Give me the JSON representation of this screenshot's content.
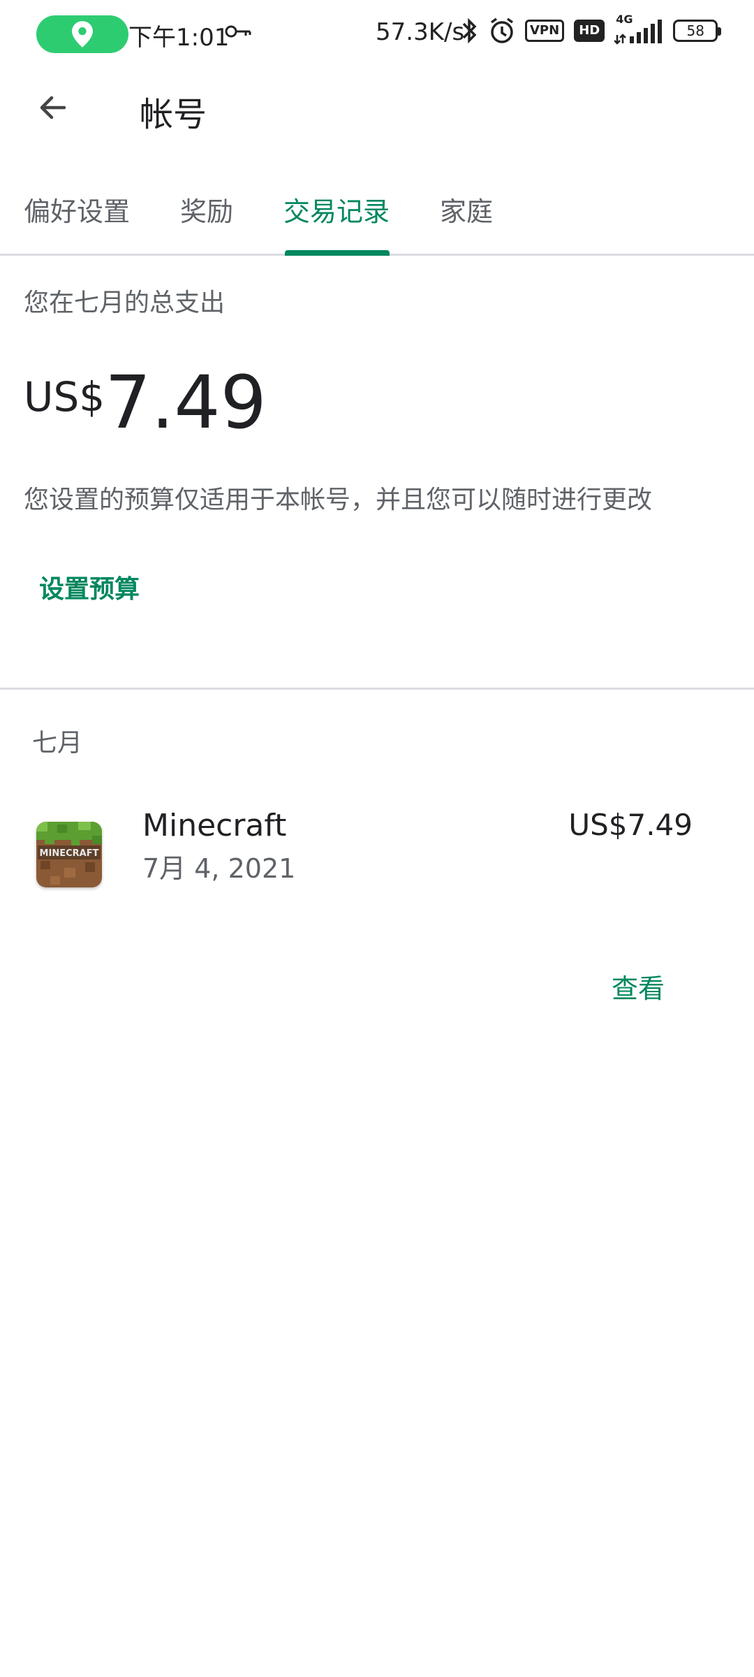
{
  "status_bar": {
    "time": "下午1:01",
    "net_speed": "57.3K/s",
    "vpn": "VPN",
    "hd": "HD",
    "network": "4G",
    "battery": "58",
    "icons": [
      "location-icon",
      "key-icon",
      "bluetooth-icon",
      "alarm-icon",
      "signal-icon"
    ]
  },
  "app_bar": {
    "title": "帐号",
    "back_icon": "arrow-back-icon"
  },
  "tabs": [
    {
      "label": "偏好设置"
    },
    {
      "label": "奖励"
    },
    {
      "label": "交易记录",
      "active": true
    },
    {
      "label": "家庭"
    }
  ],
  "summary": {
    "label": "您在七月的总支出",
    "currency": "US$",
    "amount": "7.49",
    "budget_note": "您设置的预算仅适用于本帐号，并且您可以随时进行更改",
    "set_budget": "设置预算"
  },
  "transactions": {
    "month": "七月",
    "items": [
      {
        "title": "Minecraft",
        "date": "7月 4, 2021",
        "price": "US$7.49",
        "icon": "minecraft-app-icon",
        "icon_text": "MINECRAFT"
      }
    ],
    "view_label": "查看"
  },
  "colors": {
    "accent": "#01875f",
    "divider": "#dadce0",
    "location_pill": "#2ecc71"
  }
}
